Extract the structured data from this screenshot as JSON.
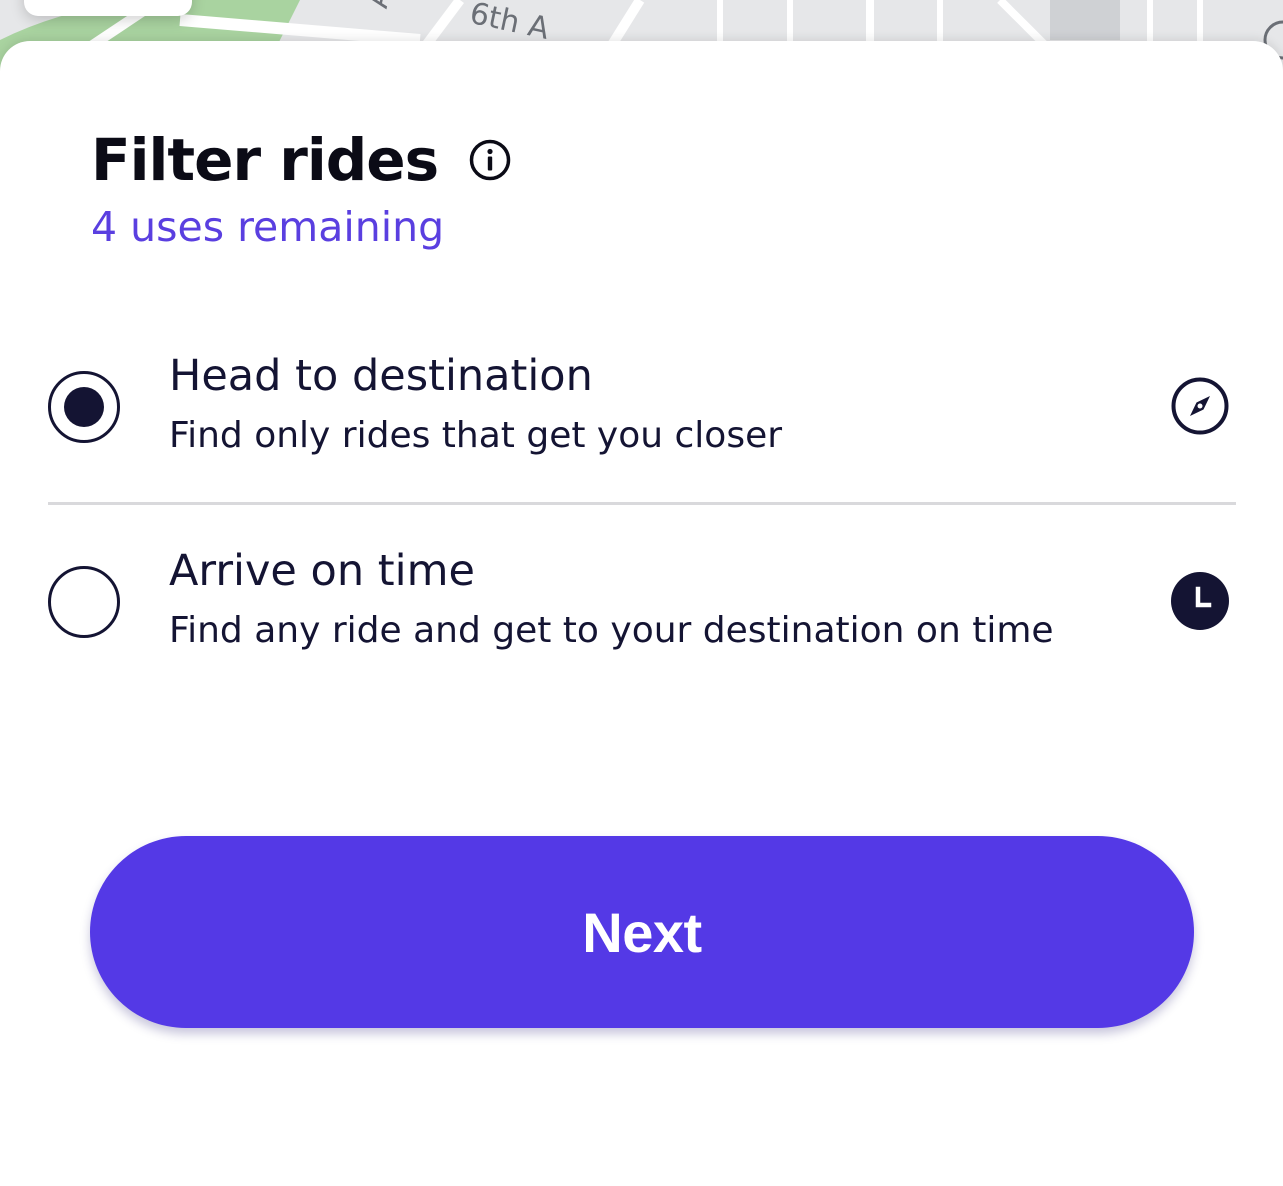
{
  "map": {
    "street_labels": [
      "A",
      "6th A"
    ]
  },
  "sheet": {
    "title": "Filter rides",
    "info_icon": "info-icon",
    "subtitle": "4 uses remaining",
    "options": [
      {
        "title": "Head to destination",
        "description": "Find only rides that get you closer",
        "selected": true,
        "icon": "compass-icon"
      },
      {
        "title": "Arrive on time",
        "description": "Find any ride and get to your destination on time",
        "selected": false,
        "icon": "clock-icon"
      }
    ],
    "next_label": "Next"
  },
  "colors": {
    "accent": "#5439e6",
    "subtitle": "#5a3fe0",
    "text_dark": "#141433",
    "divider": "#d9d9dc"
  }
}
